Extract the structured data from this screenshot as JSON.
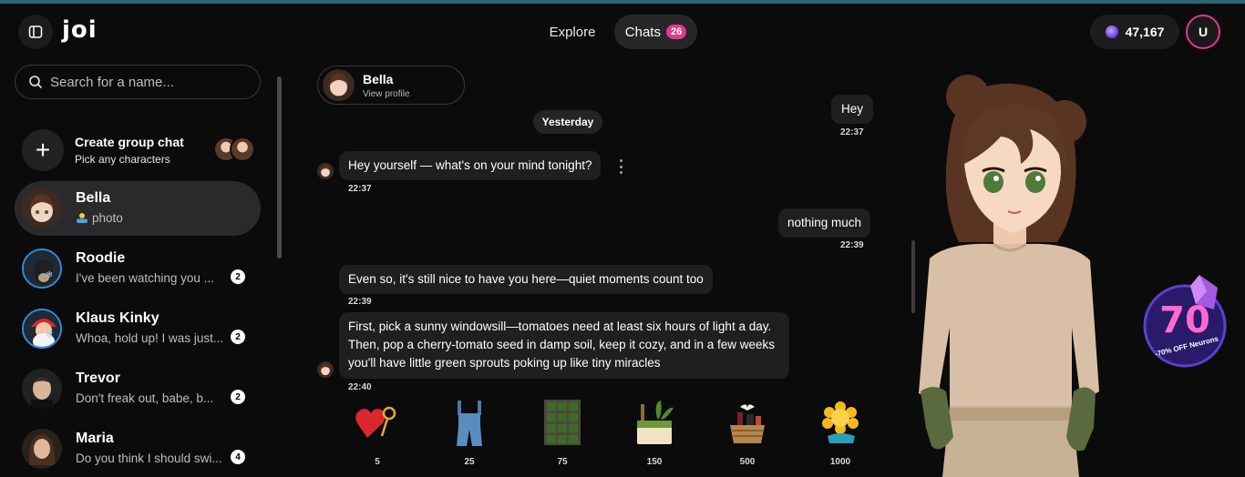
{
  "app": {
    "logo": "joi"
  },
  "header": {
    "nav": [
      {
        "label": "Explore"
      },
      {
        "label": "Chats",
        "badge": "26"
      }
    ],
    "neurons_balance": "47,167",
    "user_initial": "U"
  },
  "sidebar": {
    "search_placeholder": "Search for a name...",
    "group_chat": {
      "title": "Create group chat",
      "subtitle": "Pick any characters"
    },
    "chats": [
      {
        "name": "Bella",
        "preview": "photo",
        "count": ""
      },
      {
        "name": "Roodie",
        "preview": "I've been watching you ...",
        "count": "2"
      },
      {
        "name": "Klaus Kinky",
        "preview": "Whoa, hold up! I was just...",
        "count": "2"
      },
      {
        "name": "Trevor",
        "preview": "Don't freak out, babe, b...",
        "count": "2"
      },
      {
        "name": "Maria",
        "preview": "Do you think I should swi...",
        "count": "4"
      }
    ]
  },
  "conversation": {
    "profile": {
      "name": "Bella",
      "link": "View profile"
    },
    "date_divider": "Yesterday",
    "messages": [
      {
        "from": "user",
        "text": "Hey",
        "time": "22:37"
      },
      {
        "from": "bot",
        "text": "Hey yourself — what's on your mind tonight?",
        "time": "22:37"
      },
      {
        "from": "user",
        "text": "nothing much",
        "time": "22:39"
      },
      {
        "from": "bot",
        "text": "Even so, it's still nice to have you here—quiet moments count too",
        "time": "22:39"
      },
      {
        "from": "bot",
        "text": "First, pick a sunny windowsill—tomatoes need at least six hours of light a day. Then, pop a cherry-tomato seed in damp soil, keep it cozy, and in a few weeks you'll have little green sprouts poking up like tiny miracles",
        "time": "22:40"
      }
    ],
    "gifts": [
      {
        "icon": "heart-lock-icon",
        "price": "5"
      },
      {
        "icon": "overalls-icon",
        "price": "25"
      },
      {
        "icon": "seed-tray-icon",
        "price": "75"
      },
      {
        "icon": "garden-kit-icon",
        "price": "150"
      },
      {
        "icon": "gift-basket-icon",
        "price": "500"
      },
      {
        "icon": "sunflower-icon",
        "price": "1000"
      }
    ]
  },
  "promo": {
    "number": "70",
    "text": "-70% OFF Neurons"
  },
  "colors": {
    "accent": "#e13a8a",
    "topline": "#2a6670",
    "bubble": "#1f1f21",
    "sidebar_active": "#2a2a2c"
  }
}
